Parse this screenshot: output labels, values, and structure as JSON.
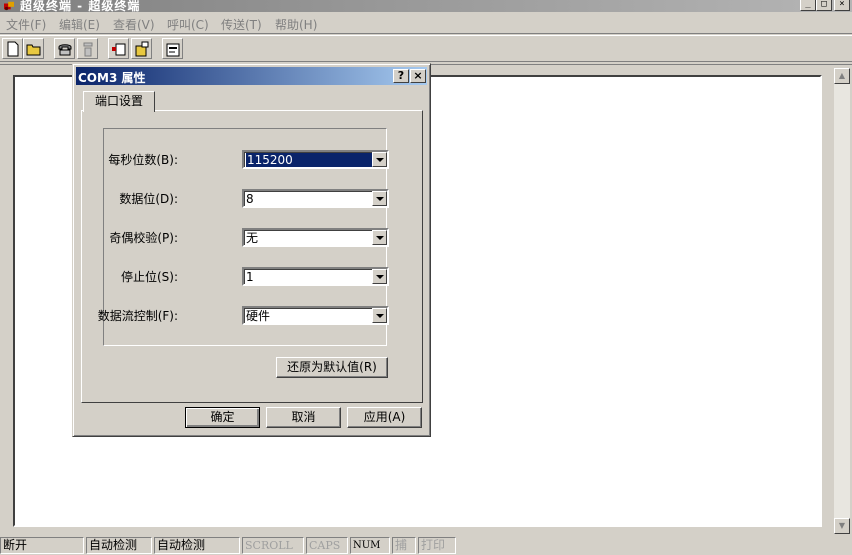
{
  "window": {
    "title": "超级终端 - 超级终端",
    "minimize": "_",
    "maximize": "□",
    "close": "×"
  },
  "menu": [
    "文件(F)",
    "编辑(E)",
    "查看(V)",
    "呼叫(C)",
    "传送(T)",
    "帮助(H)"
  ],
  "toolbar": {
    "buttons": [
      "new-icon",
      "open-icon",
      "call-icon",
      "disconnect-icon",
      "send-icon",
      "receive-icon",
      "properties-icon"
    ]
  },
  "dialog": {
    "title": "COM3 属性",
    "help_btn": "?",
    "close_btn": "×",
    "tab": "端口设置",
    "fields": [
      {
        "label": "每秒位数(B):",
        "value": "115200"
      },
      {
        "label": "数据位(D):",
        "value": "8"
      },
      {
        "label": "奇偶校验(P):",
        "value": "无"
      },
      {
        "label": "停止位(S):",
        "value": "1"
      },
      {
        "label": "数据流控制(F):",
        "value": "硬件"
      }
    ],
    "restore_button": "还原为默认值(R)",
    "ok_button": "确定",
    "cancel_button": "取消",
    "apply_button": "应用(A)"
  },
  "statusbar": {
    "connection": "断开",
    "detect1": "自动检测",
    "detect2": "自动检测",
    "scroll": "SCROLL",
    "caps": "CAPS",
    "num": "NUM",
    "capture": "捕",
    "print": "打印"
  },
  "colors": {
    "dialog_title": "#0a246a",
    "face": "#d4d0c8"
  }
}
